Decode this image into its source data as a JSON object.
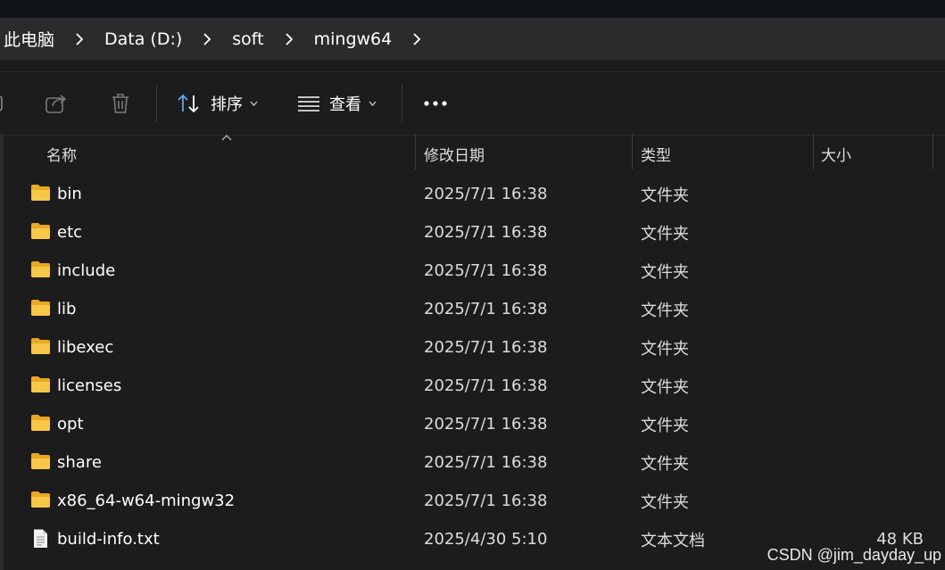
{
  "breadcrumb": [
    "此电脑",
    "Data (D:)",
    "soft",
    "mingw64"
  ],
  "toolbar": {
    "sort_label": "排序",
    "view_label": "查看"
  },
  "columns": {
    "name": "名称",
    "modified": "修改日期",
    "type": "类型",
    "size": "大小"
  },
  "rows": [
    {
      "name": "bin",
      "modified": "2025/7/1 16:38",
      "type": "文件夹",
      "size": "",
      "icon": "folder-icon"
    },
    {
      "name": "etc",
      "modified": "2025/7/1 16:38",
      "type": "文件夹",
      "size": "",
      "icon": "folder-icon"
    },
    {
      "name": "include",
      "modified": "2025/7/1 16:38",
      "type": "文件夹",
      "size": "",
      "icon": "folder-icon"
    },
    {
      "name": "lib",
      "modified": "2025/7/1 16:38",
      "type": "文件夹",
      "size": "",
      "icon": "folder-icon"
    },
    {
      "name": "libexec",
      "modified": "2025/7/1 16:38",
      "type": "文件夹",
      "size": "",
      "icon": "folder-icon"
    },
    {
      "name": "licenses",
      "modified": "2025/7/1 16:38",
      "type": "文件夹",
      "size": "",
      "icon": "folder-icon"
    },
    {
      "name": "opt",
      "modified": "2025/7/1 16:38",
      "type": "文件夹",
      "size": "",
      "icon": "folder-icon"
    },
    {
      "name": "share",
      "modified": "2025/7/1 16:38",
      "type": "文件夹",
      "size": "",
      "icon": "folder-icon"
    },
    {
      "name": "x86_64-w64-mingw32",
      "modified": "2025/7/1 16:38",
      "type": "文件夹",
      "size": "",
      "icon": "folder-icon"
    },
    {
      "name": "build-info.txt",
      "modified": "2025/4/30 5:10",
      "type": "文本文档",
      "size": "48 KB",
      "icon": "text-file-icon"
    }
  ],
  "watermark": "CSDN @jim_dayday_up",
  "colors": {
    "background": "#1c1c1c",
    "addressbar": "#2b2b2b",
    "folder": "#f7c747",
    "accent": "#60a9e6"
  }
}
